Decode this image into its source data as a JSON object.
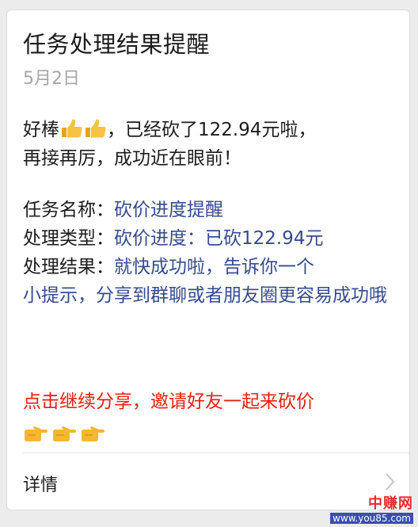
{
  "card": {
    "title": "任务处理结果提醒",
    "date": "5月2日",
    "lead_part1": "好棒",
    "lead_part2": "，已经砍了122.94元啦，",
    "lead_line2": "再接再厉，成功近在眼前！",
    "fields": [
      {
        "key": "任务名称：",
        "value": "砍价进度提醒"
      },
      {
        "key": "处理类型：",
        "value": "砍价进度：已砍122.94元"
      },
      {
        "key": "处理结果：",
        "value": "就快成功啦，告诉你一个"
      }
    ],
    "result_continued": "小提示，分享到群聊或者朋友圈更容易成功哦",
    "cta": "点击继续分享，邀请好友一起来砍价",
    "detail_label": "详情",
    "icons": {
      "thumbs": "thumbs-up-emoji",
      "pointing": "pointing-right-emoji",
      "chevron": "chevron-right-icon"
    }
  },
  "watermark": {
    "name": "中赚网",
    "url": "www.you85.com"
  },
  "colors": {
    "text": "#1c1c1c",
    "muted": "#a6a6a6",
    "value": "#354b8e",
    "cta": "#e6200e"
  }
}
